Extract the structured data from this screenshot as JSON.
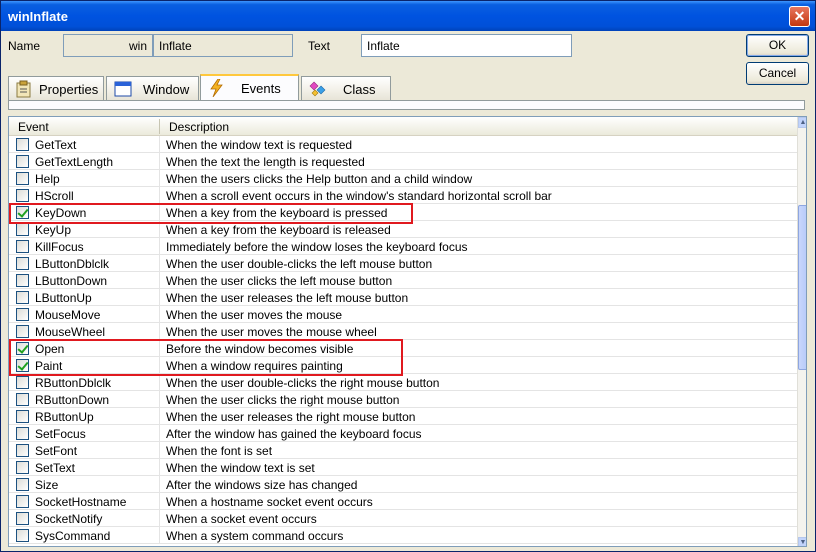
{
  "window": {
    "title": "winInflate"
  },
  "form": {
    "name_label": "Name",
    "name_prefix": "win",
    "name_value": "Inflate",
    "text_label": "Text",
    "text_value": "Inflate"
  },
  "buttons": {
    "ok": "OK",
    "cancel": "Cancel",
    "close": "✕"
  },
  "tabs": [
    {
      "label": "Properties",
      "icon": "properties-icon"
    },
    {
      "label": "Window",
      "icon": "window-icon"
    },
    {
      "label": "Events",
      "icon": "lightning-icon",
      "active": true
    },
    {
      "label": "Class",
      "icon": "class-icon"
    }
  ],
  "grid": {
    "columns": [
      "Event",
      "Description"
    ],
    "rows": [
      {
        "event": "GetText",
        "description": "When the window text is requested",
        "checked": false
      },
      {
        "event": "GetTextLength",
        "description": "When the text the length is requested",
        "checked": false
      },
      {
        "event": "Help",
        "description": "When the users clicks the Help button and a child window",
        "checked": false
      },
      {
        "event": "HScroll",
        "description": "When a scroll event occurs in the window's standard horizontal scroll bar",
        "checked": false
      },
      {
        "event": "KeyDown",
        "description": "When a key from the keyboard is pressed",
        "checked": true
      },
      {
        "event": "KeyUp",
        "description": "When a key from the keyboard is released",
        "checked": false
      },
      {
        "event": "KillFocus",
        "description": "Immediately before the window loses the keyboard focus",
        "checked": false
      },
      {
        "event": "LButtonDblclk",
        "description": "When the user double-clicks the left mouse button",
        "checked": false
      },
      {
        "event": "LButtonDown",
        "description": "When the user clicks the left mouse button",
        "checked": false
      },
      {
        "event": "LButtonUp",
        "description": "When the user releases the left mouse button",
        "checked": false
      },
      {
        "event": "MouseMove",
        "description": "When the user moves the mouse",
        "checked": false
      },
      {
        "event": "MouseWheel",
        "description": "When the user moves the mouse wheel",
        "checked": false
      },
      {
        "event": "Open",
        "description": "Before the window becomes visible",
        "checked": true
      },
      {
        "event": "Paint",
        "description": "When a window requires painting",
        "checked": true
      },
      {
        "event": "RButtonDblclk",
        "description": "When the user double-clicks the right mouse button",
        "checked": false
      },
      {
        "event": "RButtonDown",
        "description": "When the user clicks the right mouse button",
        "checked": false
      },
      {
        "event": "RButtonUp",
        "description": "When the user releases the right mouse button",
        "checked": false
      },
      {
        "event": "SetFocus",
        "description": "After the window has gained the keyboard focus",
        "checked": false
      },
      {
        "event": "SetFont",
        "description": "When the font is set",
        "checked": false
      },
      {
        "event": "SetText",
        "description": "When the window text is set",
        "checked": false
      },
      {
        "event": "Size",
        "description": "After the windows size has changed",
        "checked": false
      },
      {
        "event": "SocketHostname",
        "description": "When a hostname socket event occurs",
        "checked": false
      },
      {
        "event": "SocketNotify",
        "description": "When a socket event occurs",
        "checked": false
      },
      {
        "event": "SysCommand",
        "description": "When a system command occurs",
        "checked": false
      }
    ]
  },
  "colors": {
    "highlight": "#e0191f",
    "checkmark": "#21a121",
    "titlebar": "#0053e0"
  }
}
